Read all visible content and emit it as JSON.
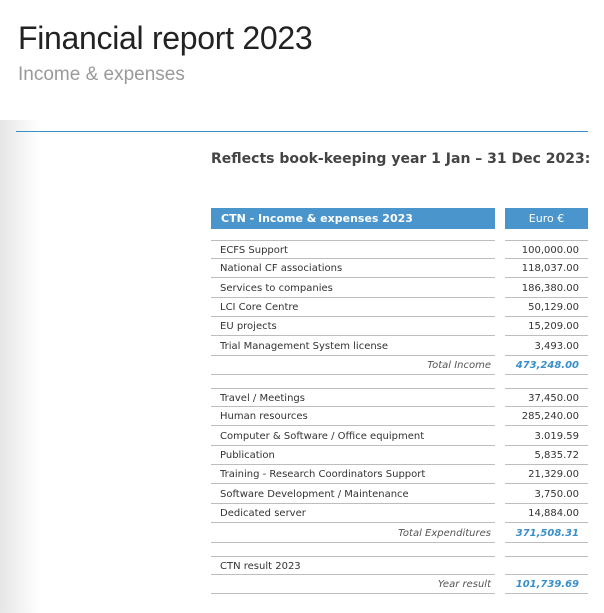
{
  "header": {
    "title": "Financial report 2023",
    "subtitle": "Income & expenses",
    "lead": "Reflects book-keeping year 1 Jan – 31 Dec 2023:"
  },
  "table": {
    "head_label": "CTN - Income & expenses 2023",
    "head_currency": "Euro €",
    "income": [
      {
        "label": "ECFS Support",
        "value": "100,000.00"
      },
      {
        "label": "National CF associations",
        "value": "118,037.00"
      },
      {
        "label": "Services to companies",
        "value": "186,380.00"
      },
      {
        "label": "LCI Core Centre",
        "value": "50,129.00"
      },
      {
        "label": "EU projects",
        "value": "15,209.00"
      },
      {
        "label": "Trial Management System license",
        "value": "3,493.00"
      }
    ],
    "total_income": {
      "label": "Total Income",
      "value": "473,248.00"
    },
    "expenses": [
      {
        "label": "Travel / Meetings",
        "value": "37,450.00"
      },
      {
        "label": "Human resources",
        "value": "285,240.00"
      },
      {
        "label": "Computer & Software / Office equipment",
        "value": "3.019.59"
      },
      {
        "label": "Publication",
        "value": "5,835.72"
      },
      {
        "label": "Training - Research Coordinators Support",
        "value": "21,329.00"
      },
      {
        "label": "Software Development / Maintenance",
        "value": "3,750.00"
      },
      {
        "label": "Dedicated server",
        "value": "14,884.00"
      }
    ],
    "total_expenditures": {
      "label": "Total Expenditures",
      "value": "371,508.31"
    },
    "result_label": "CTN result 2023",
    "year_result": {
      "label": "Year result",
      "value": "101,739.69"
    }
  }
}
